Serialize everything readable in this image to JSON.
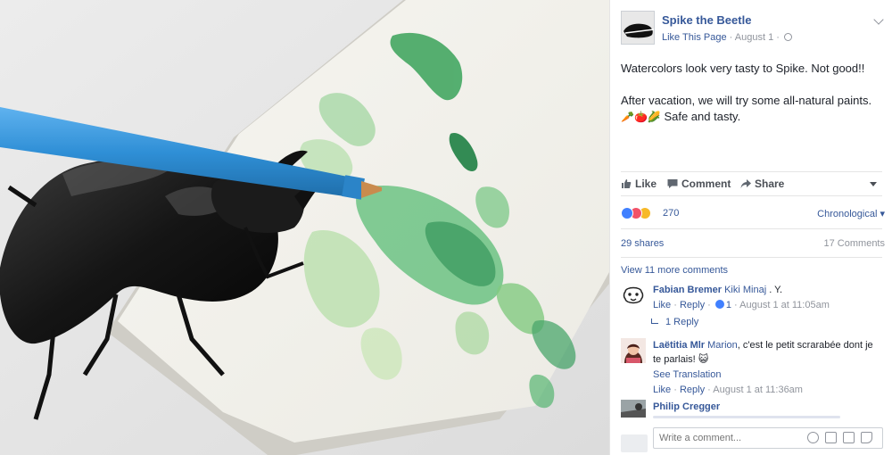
{
  "post": {
    "page_name": "Spike the Beetle",
    "like_link": "Like This Page",
    "date": "August 1",
    "paragraph_1": "Watercolors look very tasty to Spike. Not good!!",
    "paragraph_2": "After vacation, we will try some all-natural paints.",
    "emojis": "🥕🍅🌽",
    "paragraph_3": " Safe and tasty."
  },
  "actions": {
    "like": "Like",
    "comment": "Comment",
    "share": "Share"
  },
  "reactions": {
    "count": "270",
    "icons": [
      "like-icon",
      "love-icon",
      "wow-icon"
    ],
    "sort": "Chronological"
  },
  "stats": {
    "shares": "29 shares",
    "comments": "17 Comments",
    "view_more": "View 11 more comments"
  },
  "comments": [
    {
      "name": "Fabian Bremer",
      "tag": "Kiki Minaj",
      "text": " . Y.",
      "like": "Like",
      "reply": "Reply",
      "likes": "1",
      "meta": "August 1 at 11:05am",
      "replies": "1 Reply"
    },
    {
      "name": "Laëtitia Mlr",
      "tag": "Marion",
      "text": ", c'est le petit scrarabée dont je te parlais! 😺",
      "see_translation": "See Translation",
      "like": "Like",
      "reply": "Reply",
      "meta": "August 1 at 11:36am"
    },
    {
      "name": "Philip Cregger"
    }
  ],
  "composer": {
    "placeholder": "Write a comment...",
    "icons": [
      "emoji-icon",
      "camera-icon",
      "gif-icon",
      "sticker-icon"
    ]
  },
  "colors": {
    "link": "#365899",
    "meta": "#90949c",
    "text": "#1d2129",
    "like_blue": "#4080ff",
    "love_red": "#f25268",
    "wow_yellow": "#f7b928",
    "brush_blue": "#3a94d8",
    "paint_green": "#2a9a4a"
  }
}
